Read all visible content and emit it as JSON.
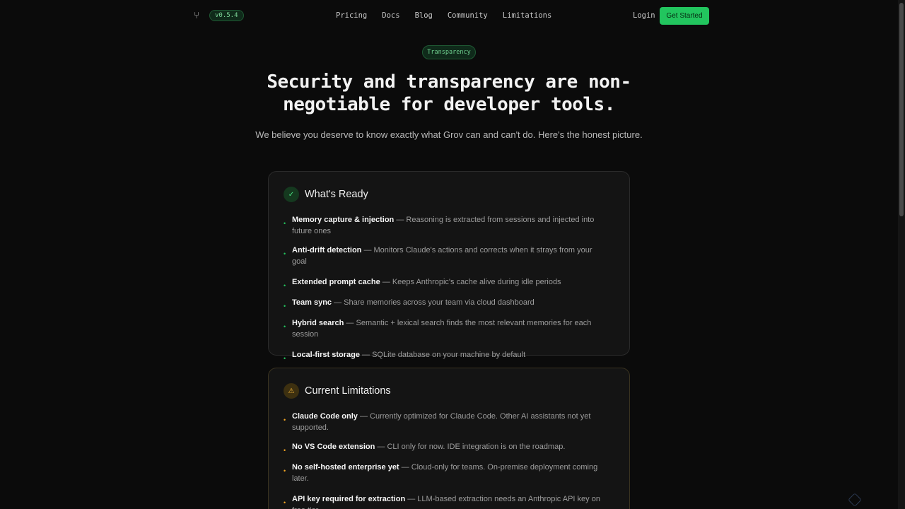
{
  "nav": {
    "logo_icon": "fork-icon",
    "version": "v0.5.4",
    "links": [
      "Pricing",
      "Docs",
      "Blog",
      "Community",
      "Limitations"
    ],
    "login": "Login",
    "cta": "Get Started"
  },
  "hero": {
    "pill": "Transparency",
    "title": "Security and transparency are non-negotiable for developer tools.",
    "subtitle": "We believe you deserve to know exactly what Grov can and can't do. Here's the honest picture."
  },
  "ready": {
    "icon": "check-icon",
    "title": "What's Ready",
    "items": [
      {
        "title": "Memory capture & injection",
        "desc": " — Reasoning is extracted from sessions and injected into future ones"
      },
      {
        "title": "Anti-drift detection",
        "desc": " — Monitors Claude's actions and corrects when it strays from your goal"
      },
      {
        "title": "Extended prompt cache",
        "desc": " — Keeps Anthropic's cache alive during idle periods"
      },
      {
        "title": "Team sync",
        "desc": " — Share memories across your team via cloud dashboard"
      },
      {
        "title": "Hybrid search",
        "desc": " — Semantic + lexical search finds the most relevant memories for each session"
      },
      {
        "title": "Local-first storage",
        "desc": " — SQLite database on your machine by default"
      }
    ]
  },
  "limits": {
    "icon": "warning-icon",
    "title": "Current Limitations",
    "items": [
      {
        "title": "Claude Code only",
        "desc": " — Currently optimized for Claude Code. Other AI assistants not yet supported."
      },
      {
        "title": "No VS Code extension",
        "desc": " — CLI only for now. IDE integration is on the roadmap."
      },
      {
        "title": "No self-hosted enterprise yet",
        "desc": " — Cloud-only for teams. On-premise deployment coming later."
      },
      {
        "title": "API key required for extraction",
        "desc": " — LLM-based extraction needs an Anthropic API key on free tier."
      }
    ]
  },
  "colors": {
    "accent": "#22c55e",
    "warning": "#f5a623",
    "background": "#0b0b0b"
  }
}
